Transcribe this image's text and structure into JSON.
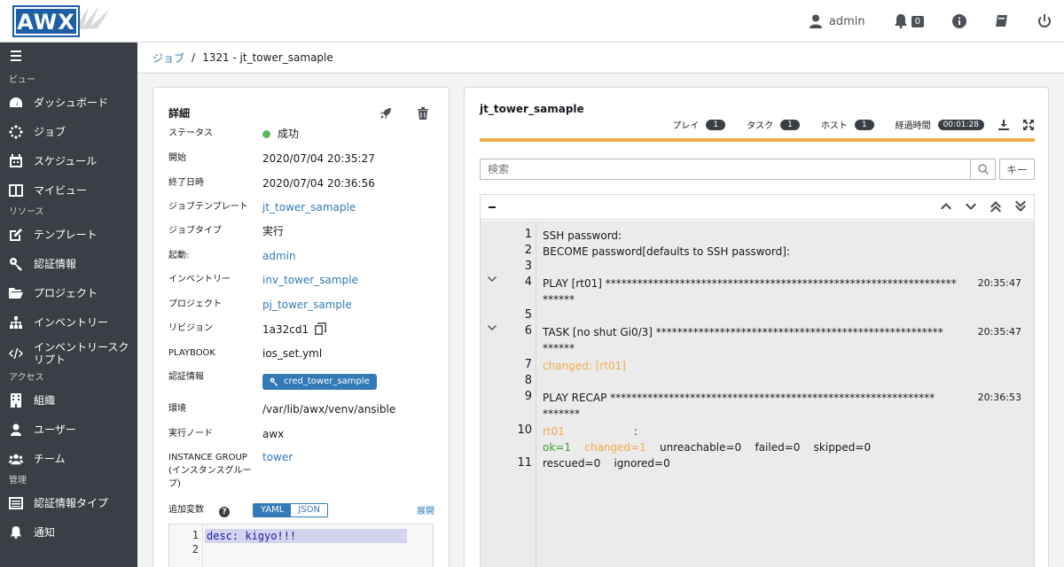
{
  "app": {
    "logo_text": "AWX"
  },
  "topbar": {
    "user": "admin",
    "notifications": "0"
  },
  "sidebar": {
    "sections": [
      "ビュー",
      "リソース",
      "アクセス",
      "管理"
    ],
    "views": [
      "ダッシュボード",
      "ジョブ",
      "スケジュール",
      "マイビュー"
    ],
    "resources": [
      "テンプレート",
      "認証情報",
      "プロジェクト",
      "インベントリー",
      "インベントリースク\nリプト"
    ],
    "access": [
      "組織",
      "ユーザー",
      "チーム"
    ],
    "admin": [
      "認証情報タイプ",
      "通知"
    ]
  },
  "breadcrumb": {
    "parent": "ジョブ",
    "current": "1321 - jt_tower_samaple"
  },
  "details": {
    "title": "詳細",
    "rows": [
      {
        "label": "ステータス",
        "value": "成功"
      },
      {
        "label": "開始",
        "value": "2020/07/04 20:35:27"
      },
      {
        "label": "終了日時",
        "value": "2020/07/04 20:36:56"
      },
      {
        "label": "ジョブテンプレート",
        "value": "jt_tower_samaple"
      },
      {
        "label": "ジョブタイプ",
        "value": "実行"
      },
      {
        "label": "起動:",
        "value": "admin"
      },
      {
        "label": "インベントリー",
        "value": "inv_tower_sample"
      },
      {
        "label": "プロジェクト",
        "value": "pj_tower_sample"
      },
      {
        "label": "リビジョン",
        "value": "1a32cd1"
      },
      {
        "label": "PLAYBOOK",
        "value": "ios_set.yml"
      },
      {
        "label": "認証情報",
        "value": "cred_tower_sample"
      },
      {
        "label": "環境",
        "value": "/var/lib/awx/venv/ansible"
      },
      {
        "label": "実行ノード",
        "value": "awx"
      },
      {
        "label": "INSTANCE GROUP (インスタンスグループ)",
        "value": "tower"
      }
    ],
    "extra_vars_label": "追加変数",
    "yaml": "YAML",
    "json": "JSON",
    "expand": "展開",
    "editor_line1": "desc: kigyo!!!",
    "editor_ln1": "1",
    "editor_ln2": "2"
  },
  "output": {
    "title": "jt_tower_samaple",
    "stats": {
      "play_label": "プレイ",
      "play": "1",
      "task_label": "タスク",
      "task": "1",
      "host_label": "ホスト",
      "host": "1",
      "elapsed_label": "経過時間",
      "elapsed": "00:01:28"
    },
    "search_placeholder": "検索",
    "key_button": "キー",
    "lines": {
      "n1": "1",
      "t1": "SSH password:",
      "n2": "2",
      "t2": "BECOME password[defaults to SSH password]:",
      "n3": "3",
      "n4": "4",
      "t4": "PLAY [rt01] ******************************************************************",
      "t4b": "******",
      "time4": "20:35:47",
      "n5": "5",
      "n6": "6",
      "t6": "TASK [no shut  Gi0/3] ******************************************************",
      "t6b": "******",
      "time6": "20:35:47",
      "n7": "7",
      "t7": "changed: [rt01]",
      "n8": "8",
      "n9": "9",
      "t9": "PLAY RECAP *************************************************************",
      "t9b": "*******",
      "time9": "20:36:53",
      "n10": "10",
      "r_host": "rt01",
      "r_colon": ": ",
      "r_ok": "ok=1",
      "r_changed": "changed=1",
      "r_unreach": "unreachable=0",
      "r_failed": "failed=0",
      "r_skipped": "skipped=0",
      "r_rescued": "rescued=0",
      "r_ignored": "ignored=0",
      "n11": "11"
    }
  },
  "colors": {
    "accent": "#337ab7",
    "sidebar": "#393f44",
    "progress": "#f0ad4e",
    "success": "#5cb85c"
  }
}
